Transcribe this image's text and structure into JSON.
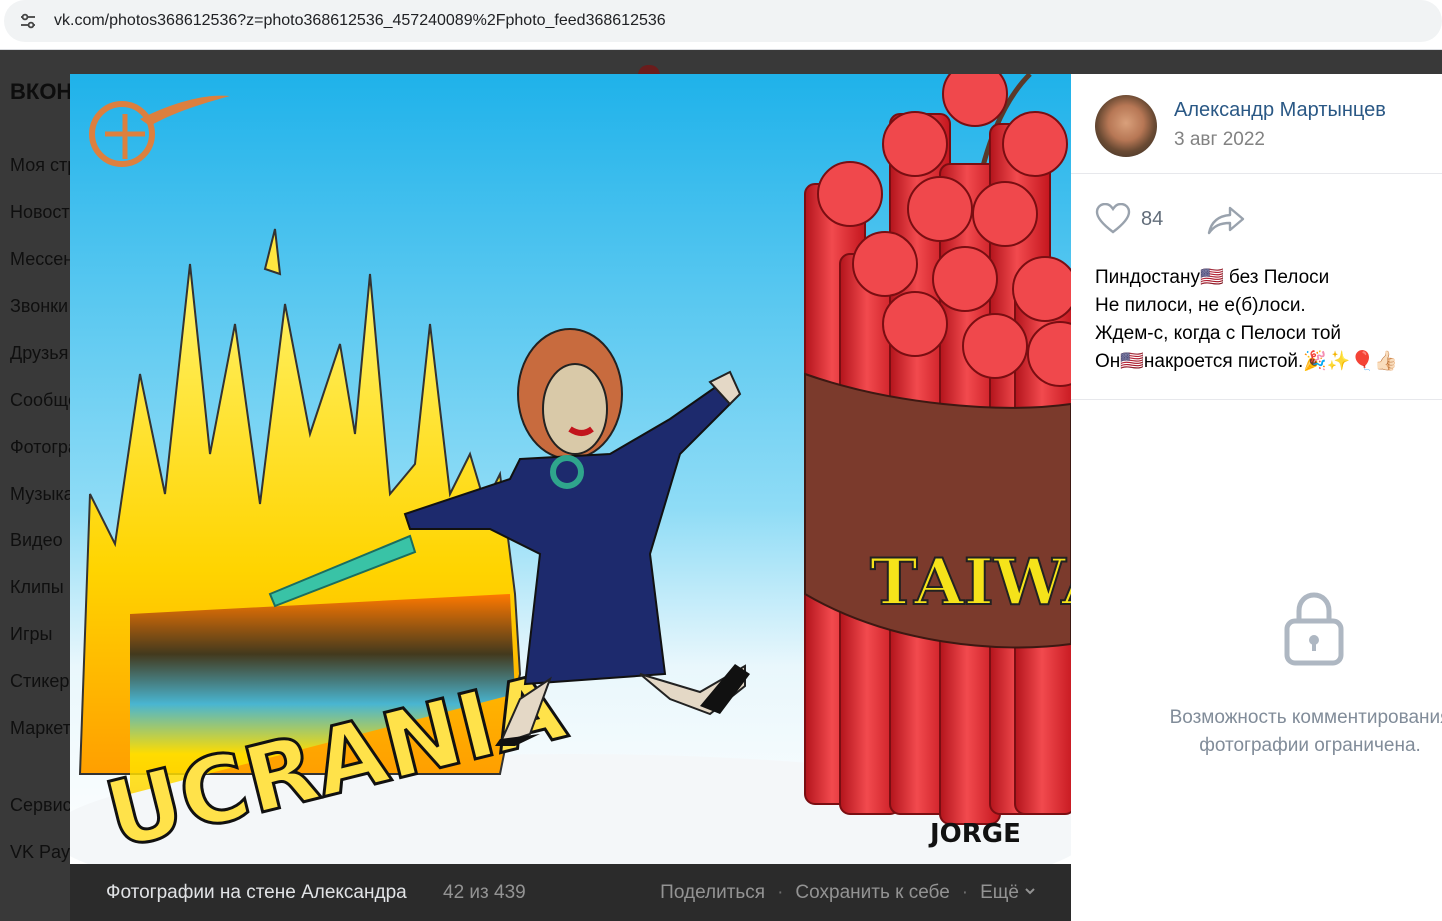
{
  "browser": {
    "url": "vk.com/photos368612536?z=photo368612536_457240089%2Fphoto_feed368612536",
    "site_info_icon": "tune-icon"
  },
  "background_page": {
    "logo": "ВКОНТАКТЕ",
    "sidebar_items": [
      "Моя страница",
      "Новости",
      "Мессенджер",
      "Звонки",
      "Друзья",
      "Сообщества",
      "Фотографии",
      "Музыка",
      "Видео",
      "Клипы",
      "Игры",
      "Стикеры",
      "Маркет",
      "Сервисы",
      "VK Pay"
    ]
  },
  "photo": {
    "watermark_logo": "Al Mayadeen logo",
    "label_left": "UCRANIA",
    "label_right": "TAIWAN",
    "signature": "JORGE"
  },
  "bottom_bar": {
    "album_title": "Фотографии на стене Александра",
    "counter": "42 из 439",
    "share": "Поделиться",
    "save": "Сохранить к себе",
    "more": "Ещё",
    "separator": "·"
  },
  "post": {
    "author": "Александр Мартынцев",
    "date": "3 авг 2022",
    "likes": "84",
    "caption_lines": [
      "Пиндостану🇺🇸 без Пелоси",
      "Не пилоси, не е(б)лоси.",
      "Ждем-с, когда с Пелоси той",
      "Он🇺🇸накроется пистой.🎉✨🎈👍🏻"
    ],
    "comments_restricted": [
      "Возможность комментирования",
      "фотографии ограничена."
    ]
  },
  "colors": {
    "link": "#2a5885",
    "muted": "#818c99",
    "dynamite": "#e8383d",
    "sky": "#4fc3ec"
  }
}
